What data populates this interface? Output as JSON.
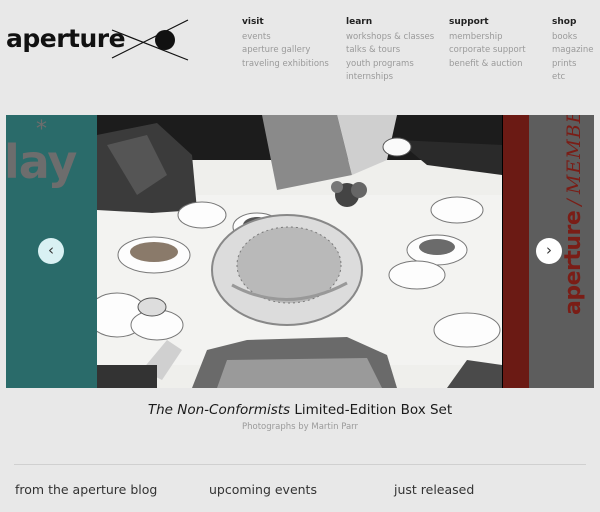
{
  "header": {
    "logo": "aperture",
    "logo_mark_icon": "x-circle-mark-icon",
    "nav": [
      {
        "heading": "visit",
        "links": [
          "events",
          "aperture gallery",
          "traveling exhibitions"
        ]
      },
      {
        "heading": "learn",
        "links": [
          "workshops & classes",
          "talks & tours",
          "youth programs",
          "internships"
        ]
      },
      {
        "heading": "support",
        "links": [
          "membership",
          "corporate support",
          "benefit & auction"
        ]
      },
      {
        "heading": "shop",
        "links": [
          "books",
          "magazine",
          "prints",
          "etc"
        ]
      }
    ]
  },
  "carousel": {
    "left_panel_text": "lay",
    "left_panel_star": "*",
    "right_panel_brand": "aperture",
    "right_panel_slash": "/",
    "right_panel_word": "MEMBERSHIP",
    "prev_icon": "‹",
    "next_icon": "›",
    "colors": {
      "left_panel": "#2a6b6a",
      "right_panel": "#6b1a14",
      "right_inner": "#5d5d5d"
    }
  },
  "feature": {
    "title_italic": "The Non-Conformists",
    "title_rest": " Limited-Edition Box Set",
    "subtitle": "Photographs by Martin Parr"
  },
  "sections": [
    "from the aperture blog",
    "upcoming events",
    "just released"
  ]
}
